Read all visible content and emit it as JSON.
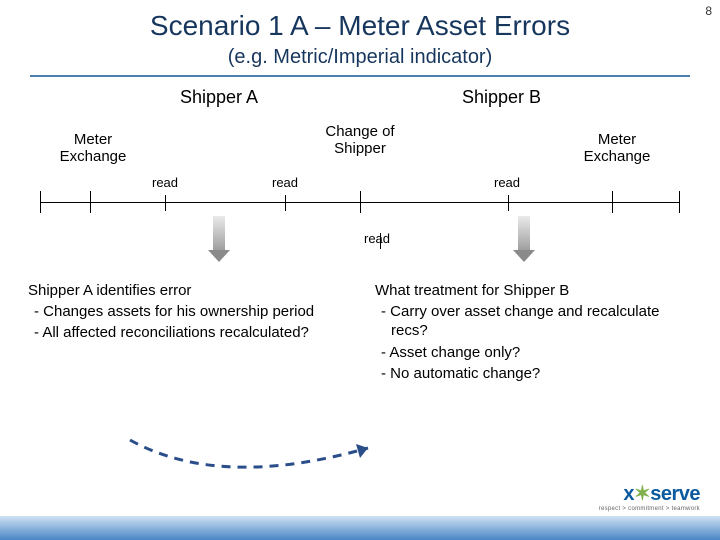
{
  "page_number": "8",
  "title": "Scenario 1 A – Meter Asset Errors",
  "subtitle": "(e.g. Metric/Imperial indicator)",
  "diagram": {
    "shipper_a": "Shipper A",
    "shipper_b": "Shipper B",
    "meter_exchange_left": "Meter Exchange",
    "meter_exchange_right": "Meter Exchange",
    "change_of_shipper": "Change of Shipper",
    "read1": "read",
    "read2": "read",
    "read3": "read",
    "read4": "read"
  },
  "left_column": {
    "lead": "Shipper A identifies error",
    "b1": "- Changes assets for his ownership period",
    "b2": "- All affected reconciliations recalculated?"
  },
  "right_column": {
    "lead": "What treatment for Shipper B",
    "b1": "- Carry over asset change and recalculate recs?",
    "b2": "- Asset change only?",
    "b3": "- No automatic change?"
  },
  "logo": {
    "name": "xoserve",
    "tagline": "respect > commitment > teamwork"
  }
}
